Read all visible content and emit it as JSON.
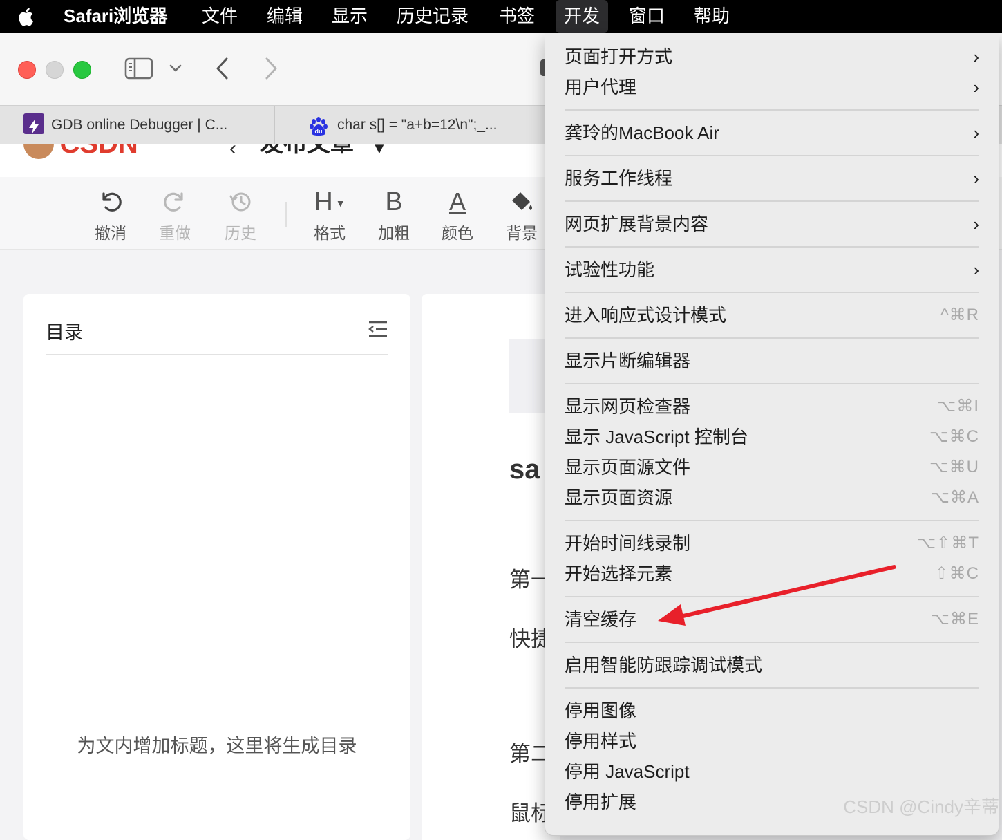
{
  "menubar": {
    "app_name": "Safari浏览器",
    "items": [
      "文件",
      "编辑",
      "显示",
      "历史记录",
      "书签",
      "开发",
      "窗口",
      "帮助"
    ],
    "active_item": "开发"
  },
  "tabs": [
    {
      "title": "GDB online Debugger | C..."
    },
    {
      "title": "char s[] = \"a+b=12\\n\";_..."
    }
  ],
  "page_header": {
    "title_partial": "发布文章"
  },
  "editor_toolbar": {
    "buttons": [
      {
        "label": "撤消",
        "icon": "undo-icon"
      },
      {
        "label": "重做",
        "icon": "redo-icon"
      },
      {
        "label": "历史",
        "icon": "history-icon"
      },
      {
        "label": "格式",
        "icon": "heading-icon",
        "glyph": "H"
      },
      {
        "label": "加粗",
        "icon": "bold-icon",
        "glyph": "B"
      },
      {
        "label": "颜色",
        "icon": "text-color-icon",
        "glyph": "A"
      },
      {
        "label": "背景",
        "icon": "paint-bucket-icon"
      }
    ]
  },
  "toc": {
    "title": "目录",
    "empty_text": "为文内增加标题，这里将生成目录"
  },
  "article_fragments": [
    "sa",
    "第一",
    "快捷",
    "第二",
    "鼠标"
  ],
  "dev_menu": {
    "items": [
      {
        "label": "页面打开方式",
        "submenu": true
      },
      {
        "label": "用户代理",
        "submenu": true
      },
      {
        "label": "龚玲的MacBook Air",
        "submenu": true
      },
      {
        "label": "服务工作线程",
        "submenu": true
      },
      {
        "label": "网页扩展背景内容",
        "submenu": true
      },
      {
        "label": "试验性功能",
        "submenu": true
      },
      {
        "label": "进入响应式设计模式",
        "shortcut": "^⌘R"
      },
      {
        "label": "显示片断编辑器"
      },
      {
        "label": "显示网页检查器",
        "shortcut": "⌥⌘I"
      },
      {
        "label": "显示 JavaScript 控制台",
        "shortcut": "⌥⌘C"
      },
      {
        "label": "显示页面源文件",
        "shortcut": "⌥⌘U"
      },
      {
        "label": "显示页面资源",
        "shortcut": "⌥⌘A"
      },
      {
        "label": "开始时间线录制",
        "shortcut": "⌥⇧⌘T"
      },
      {
        "label": "开始选择元素",
        "shortcut": "⇧⌘C"
      },
      {
        "label": "清空缓存",
        "shortcut": "⌥⌘E"
      },
      {
        "label": "启用智能防跟踪调试模式"
      },
      {
        "label": "停用图像"
      },
      {
        "label": "停用样式"
      },
      {
        "label": "停用 JavaScript"
      },
      {
        "label": "停用扩展"
      }
    ]
  },
  "watermark": "CSDN @Cindy辛蒂",
  "colors": {
    "annotation_arrow": "#e8202a",
    "close": "#ff5f57",
    "minimize": "#d6d6d6",
    "zoom": "#28c840"
  }
}
